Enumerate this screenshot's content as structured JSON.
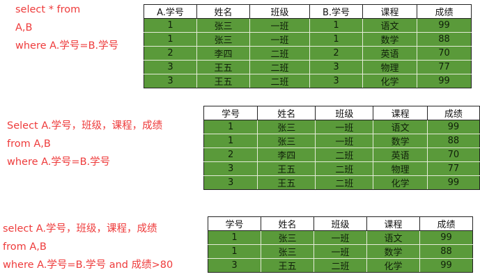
{
  "query1": {
    "lines": [
      "select * from",
      "A,B",
      "where A.学号=B.学号"
    ],
    "table": {
      "headers": [
        "A.学号",
        "姓名",
        "班级",
        "B.学号",
        "课程",
        "成绩"
      ],
      "rows": [
        [
          "1",
          "张三",
          "一班",
          "1",
          "语文",
          "99"
        ],
        [
          "1",
          "张三",
          "一班",
          "1",
          "数学",
          "88"
        ],
        [
          "2",
          "李四",
          "二班",
          "2",
          "英语",
          "70"
        ],
        [
          "3",
          "王五",
          "二班",
          "3",
          "物理",
          "77"
        ],
        [
          "3",
          "王五",
          "二班",
          "3",
          "化学",
          "99"
        ]
      ]
    }
  },
  "query2": {
    "lines": [
      "Select A.学号，班级，课程，成绩",
      "from A,B",
      "where A.学号=B.学号"
    ],
    "table": {
      "headers": [
        "学号",
        "姓名",
        "班级",
        "课程",
        "成绩"
      ],
      "rows": [
        [
          "1",
          "张三",
          "一班",
          "语文",
          "99"
        ],
        [
          "1",
          "张三",
          "一班",
          "数学",
          "88"
        ],
        [
          "2",
          "李四",
          "二班",
          "英语",
          "70"
        ],
        [
          "3",
          "王五",
          "二班",
          "物理",
          "77"
        ],
        [
          "3",
          "王五",
          "二班",
          "化学",
          "99"
        ]
      ]
    }
  },
  "query3": {
    "lines": [
      "select A.学号，班级，课程，成绩",
      "from A,B",
      "where A.学号=B.学号 and 成绩>80"
    ],
    "table": {
      "headers": [
        "学号",
        "姓名",
        "班级",
        "课程",
        "成绩"
      ],
      "rows": [
        [
          "1",
          "张三",
          "一班",
          "语文",
          "99"
        ],
        [
          "1",
          "张三",
          "一班",
          "数学",
          "88"
        ],
        [
          "3",
          "王五",
          "二班",
          "化学",
          "99"
        ]
      ]
    }
  },
  "colors": {
    "sql_text": "#ee3b3b",
    "cell_fill": "#5a9a3a",
    "header_fill": "#ffffff"
  }
}
